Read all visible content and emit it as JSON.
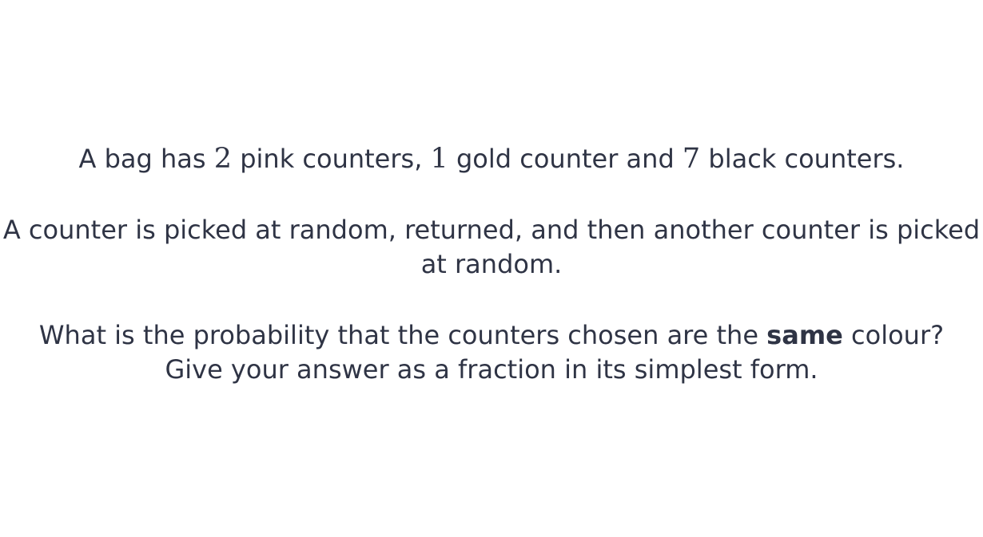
{
  "question": {
    "p1": {
      "t1": "A bag has ",
      "n1": "2",
      "t2": " pink counters, ",
      "n2": "1",
      "t3": " gold counter and ",
      "n3": "7",
      "t4": " black counters."
    },
    "p2": {
      "text": "A counter is picked at random, returned, and then another counter is picked at random."
    },
    "p3": {
      "t1": "What is the probability that the counters chosen are the ",
      "bold": "same",
      "t2": " colour?",
      "line2": "Give your answer as a fraction in its simplest form."
    }
  }
}
